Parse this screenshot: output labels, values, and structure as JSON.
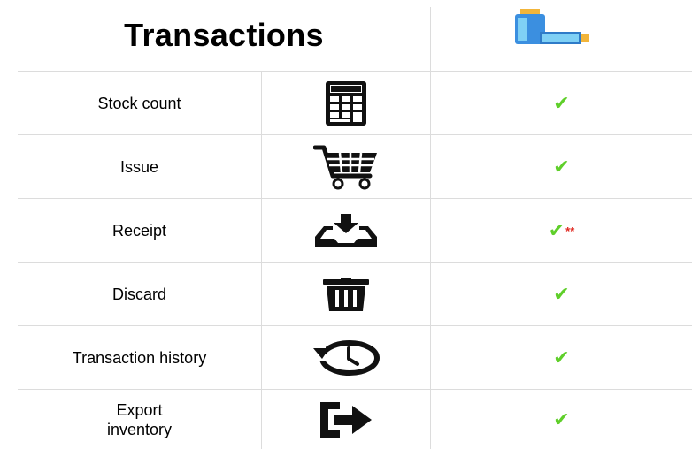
{
  "header": {
    "title": "Transactions",
    "logo_icon": "vial-icon"
  },
  "rows": [
    {
      "label": "Stock count",
      "icon": "calculator-icon",
      "check": "✔",
      "note": ""
    },
    {
      "label": "Issue",
      "icon": "shopping-cart-icon",
      "check": "✔",
      "note": ""
    },
    {
      "label": "Receipt",
      "icon": "inbox-download-icon",
      "check": "✔",
      "note": "**"
    },
    {
      "label": "Discard",
      "icon": "trash-icon",
      "check": "✔",
      "note": ""
    },
    {
      "label": "Transaction history",
      "icon": "history-icon",
      "check": "✔",
      "note": ""
    },
    {
      "label_lines": [
        "Export",
        "inventory"
      ],
      "icon": "export-icon",
      "check": "✔",
      "note": ""
    }
  ],
  "colors": {
    "check": "#5fcf2a",
    "note": "#e0261e",
    "grid": "#dcdcdc"
  }
}
